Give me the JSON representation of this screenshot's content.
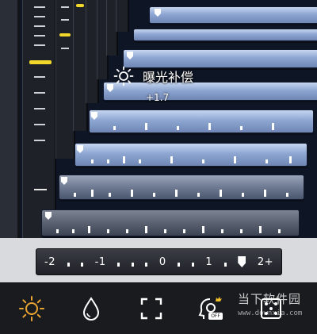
{
  "exposure": {
    "label": "曝光补偿",
    "value": "+1.7",
    "icon": "sun-icon"
  },
  "scale": {
    "labels": [
      "-2",
      "-1",
      "0",
      "1",
      "2+"
    ]
  },
  "toolbar": {
    "buttons": [
      {
        "name": "exposure-button",
        "icon": "sun-icon",
        "active": true,
        "color": "#e8a532"
      },
      {
        "name": "white-balance-button",
        "icon": "drop-icon",
        "active": false
      },
      {
        "name": "focus-button",
        "icon": "focus-frame-icon",
        "active": false
      },
      {
        "name": "hdr-button",
        "icon": "face-icon",
        "active": false,
        "badge": "OFF"
      },
      {
        "name": "grid-button",
        "icon": "dice-icon",
        "active": false
      }
    ]
  },
  "watermark": {
    "text": "当下软件园",
    "url": "www.downxia.com"
  },
  "colors": {
    "accent": "#e8a532",
    "selected_tick": "#f2d82a"
  }
}
